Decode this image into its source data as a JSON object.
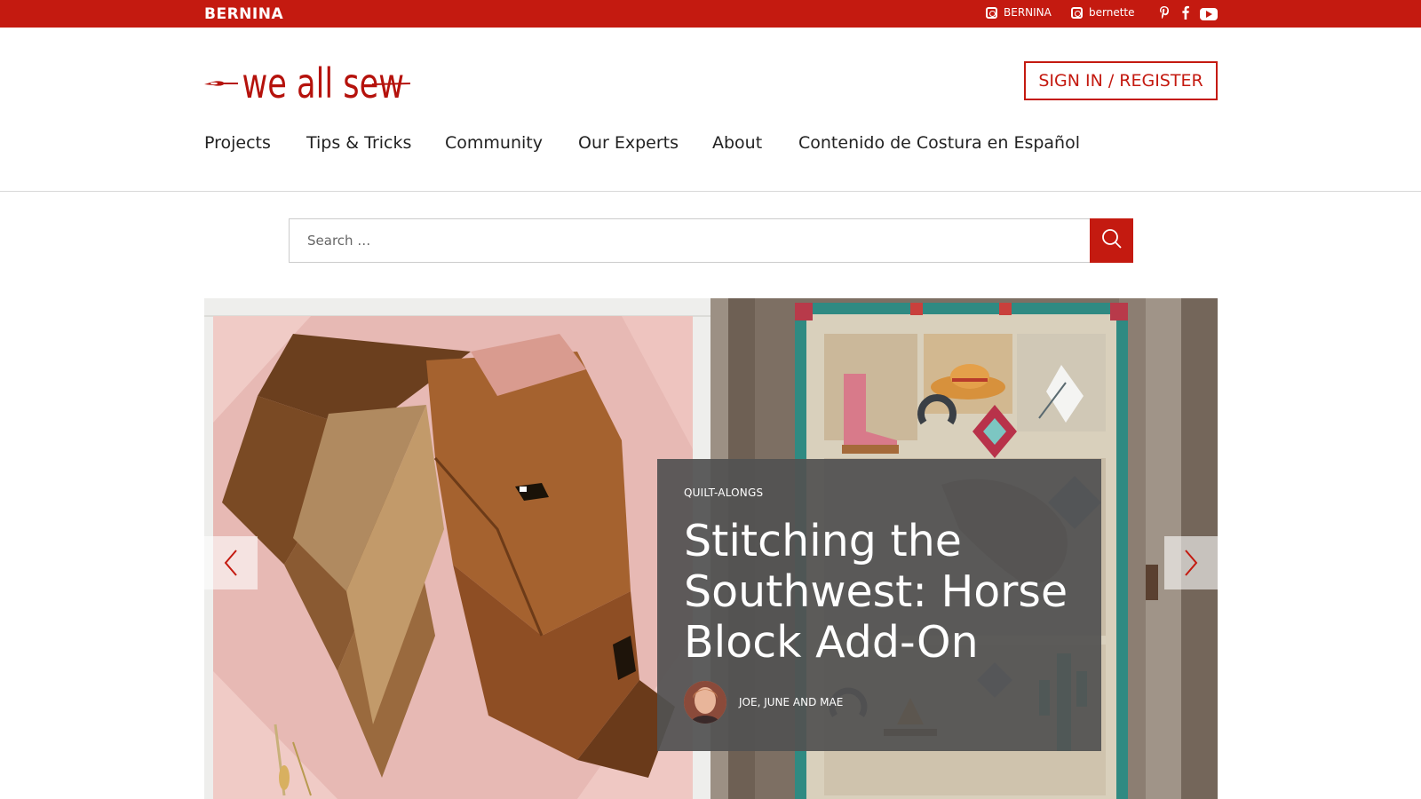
{
  "topbar": {
    "brand": "BERNINA",
    "instagram_1": "BERNINA",
    "instagram_2": "bernette",
    "icons": [
      "instagram-icon",
      "instagram-icon",
      "pinterest-icon",
      "facebook-icon",
      "youtube-icon"
    ]
  },
  "header": {
    "logo_text": "we all sew",
    "signin_label": "SIGN IN / REGISTER"
  },
  "nav": {
    "items": [
      "Projects",
      "Tips & Tricks",
      "Community",
      "Our Experts",
      "About",
      "Contenido de Costura en Español"
    ]
  },
  "search": {
    "placeholder": "Search …"
  },
  "hero": {
    "category": "QUILT-ALONGS",
    "title": "Stitching the Southwest: Horse Block Add-On",
    "author": "JOE, JUNE AND MAE"
  },
  "colors": {
    "brand_red": "#c41a10",
    "overlay": "#525252"
  }
}
